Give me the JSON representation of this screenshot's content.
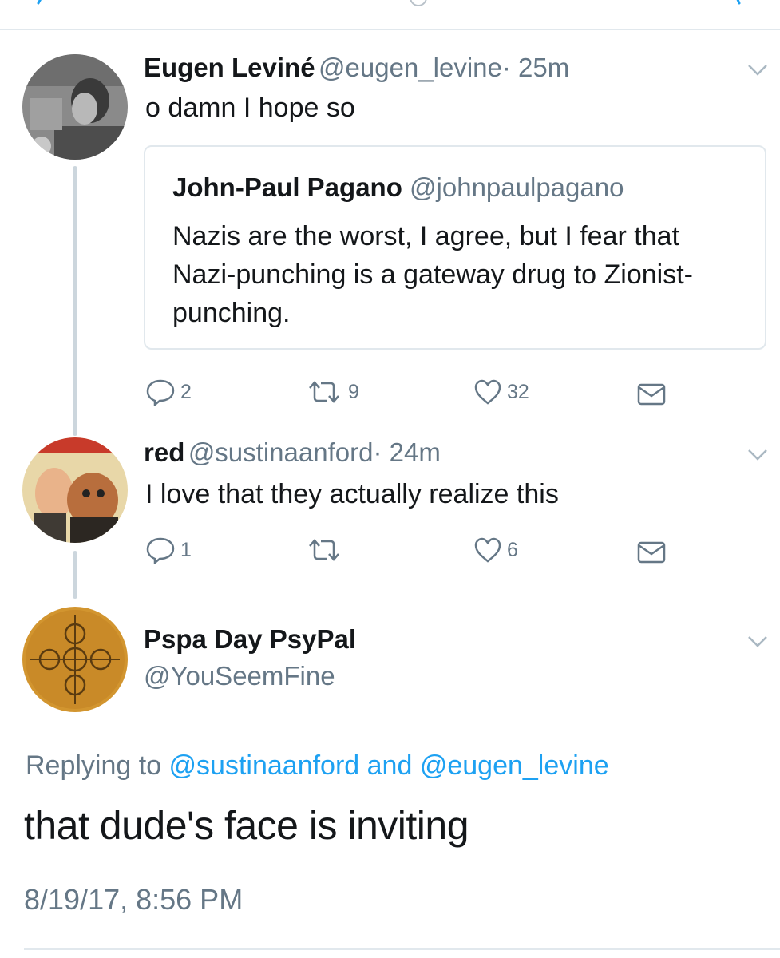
{
  "tweets": [
    {
      "name": "Eugen Leviné",
      "handle": "@eugen_levine",
      "time": "· 25m",
      "text": "o damn I hope so",
      "quote": {
        "name": "John-Paul Pagano",
        "handle": "@johnpaulpagano",
        "text": "Nazis are the worst, I agree, but I fear that Nazi-punching is a gateway drug to Zionist-punching."
      },
      "actions": {
        "replies": "2",
        "retweets": "9",
        "likes": "32"
      }
    },
    {
      "name": "red",
      "handle": "@sustinaanford",
      "time": "· 24m",
      "text": "I love that they actually realize this",
      "actions": {
        "replies": "1",
        "retweets": "",
        "likes": "6"
      }
    }
  ],
  "main_tweet": {
    "name": "Pspa Day PsyPal",
    "handle": "@YouSeemFine",
    "replying_prefix": "Replying to ",
    "replying_user1": "@sustinaanford",
    "replying_and": " and ",
    "replying_user2": "@eugen_levine",
    "text": "that dude's face is inviting",
    "timestamp": "8/19/17, 8:56 PM"
  },
  "colors": {
    "link": "#1da1f2",
    "muted": "#657786",
    "border": "#e1e8ed",
    "thread": "#ccd6dd"
  },
  "icons": [
    "reply-icon",
    "retweet-icon",
    "like-icon",
    "dm-icon",
    "chevron-down-icon"
  ]
}
